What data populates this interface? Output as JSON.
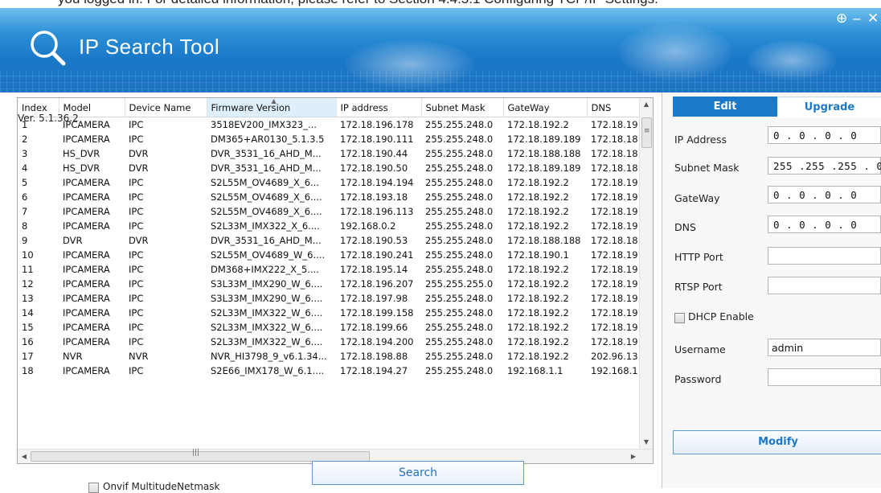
{
  "doc_text": "you logged in. For detailed information, please refer to Section 4.4.5.1 Configuring TCP/IP Settings.",
  "window": {
    "title": "IP Search Tool",
    "add_glyph": "⊕",
    "minimize_glyph": "–",
    "close_glyph": "✕"
  },
  "grid": {
    "columns": [
      "Index",
      "Model",
      "Device Name",
      "Firmware Version",
      "IP address",
      "Subnet Mask",
      "GateWay",
      "DNS"
    ],
    "rows": [
      [
        "1",
        "IPCAMERA",
        "IPC",
        "3518EV200_IMX323_...",
        "172.18.196.178",
        "255.255.248.0",
        "172.18.192.2",
        "172.18.19"
      ],
      [
        "2",
        "IPCAMERA",
        "IPC",
        "DM365+AR0130_5.1.3.5",
        "172.18.190.111",
        "255.255.248.0",
        "172.18.189.189",
        "172.18.18"
      ],
      [
        "3",
        "HS_DVR",
        "DVR",
        "DVR_3531_16_AHD_M...",
        "172.18.190.44",
        "255.255.248.0",
        "172.18.188.188",
        "172.18.18"
      ],
      [
        "4",
        "HS_DVR",
        "DVR",
        "DVR_3531_16_AHD_M...",
        "172.18.190.50",
        "255.255.248.0",
        "172.18.189.189",
        "172.18.18"
      ],
      [
        "5",
        "IPCAMERA",
        "IPC",
        "S2L55M_OV4689_X_6...",
        "172.18.194.194",
        "255.255.248.0",
        "172.18.192.2",
        "172.18.19"
      ],
      [
        "6",
        "IPCAMERA",
        "IPC",
        "S2L55M_OV4689_X_6....",
        "172.18.193.18",
        "255.255.248.0",
        "172.18.192.2",
        "172.18.19"
      ],
      [
        "7",
        "IPCAMERA",
        "IPC",
        "S2L55M_OV4689_X_6....",
        "172.18.196.113",
        "255.255.248.0",
        "172.18.192.2",
        "172.18.19"
      ],
      [
        "8",
        "IPCAMERA",
        "IPC",
        "S2L33M_IMX322_X_6....",
        "192.168.0.2",
        "255.255.248.0",
        "172.18.192.2",
        "172.18.19"
      ],
      [
        "9",
        "DVR",
        "DVR",
        "DVR_3531_16_AHD_M...",
        "172.18.190.53",
        "255.255.248.0",
        "172.18.188.188",
        "172.18.18"
      ],
      [
        "10",
        "IPCAMERA",
        "IPC",
        "S2L55M_OV4689_W_6....",
        "172.18.190.241",
        "255.255.248.0",
        "172.18.190.1",
        "172.18.19"
      ],
      [
        "11",
        "IPCAMERA",
        "IPC",
        "DM368+IMX222_X_5....",
        "172.18.195.14",
        "255.255.248.0",
        "172.18.192.2",
        "172.18.19"
      ],
      [
        "12",
        "IPCAMERA",
        "IPC",
        "S3L33M_IMX290_W_6....",
        "172.18.196.207",
        "255.255.255.0",
        "172.18.192.2",
        "172.18.19"
      ],
      [
        "13",
        "IPCAMERA",
        "IPC",
        "S3L33M_IMX290_W_6....",
        "172.18.197.98",
        "255.255.248.0",
        "172.18.192.2",
        "172.18.19"
      ],
      [
        "14",
        "IPCAMERA",
        "IPC",
        "S2L33M_IMX322_W_6....",
        "172.18.199.158",
        "255.255.248.0",
        "172.18.192.2",
        "172.18.19"
      ],
      [
        "15",
        "IPCAMERA",
        "IPC",
        "S2L33M_IMX322_W_6....",
        "172.18.199.66",
        "255.255.248.0",
        "172.18.192.2",
        "172.18.19"
      ],
      [
        "16",
        "IPCAMERA",
        "IPC",
        "S2L33M_IMX322_W_6....",
        "172.18.194.200",
        "255.255.248.0",
        "172.18.192.2",
        "172.18.19"
      ],
      [
        "17",
        "NVR",
        "NVR",
        "NVR_HI3798_9_v6.1.34...",
        "172.18.198.88",
        "255.255.248.0",
        "172.18.192.2",
        "202.96.13"
      ],
      [
        "18",
        "IPCAMERA",
        "IPC",
        "S2E66_IMX178_W_6.1....",
        "172.18.194.27",
        "255.255.248.0",
        "192.168.1.1",
        "192.168.1"
      ]
    ]
  },
  "bottom": {
    "version": "Ver. 5.1.36.2",
    "onvif_label": "Onvif MultitudeNetmask",
    "search_label": "Search"
  },
  "panel": {
    "tabs": [
      "Edit",
      "Upgrade"
    ],
    "fields": {
      "ip_label": "IP Address",
      "ip_value": "0 . 0 . 0 . 0",
      "mask_label": "Subnet Mask",
      "mask_value": "255 .255 .255 . 0",
      "gw_label": "GateWay",
      "gw_value": "0 . 0 . 0 . 0",
      "dns_label": "DNS",
      "dns_value": "0 . 0 . 0 . 0",
      "http_label": "HTTP Port",
      "http_value": "",
      "rtsp_label": "RTSP Port",
      "rtsp_value": "",
      "dhcp_label": "DHCP Enable",
      "user_label": "Username",
      "user_value": "admin",
      "pass_label": "Password",
      "pass_value": ""
    },
    "modify_label": "Modify"
  },
  "colors": {
    "accent": "#1c78c9",
    "banner": "#2c8fd6"
  }
}
